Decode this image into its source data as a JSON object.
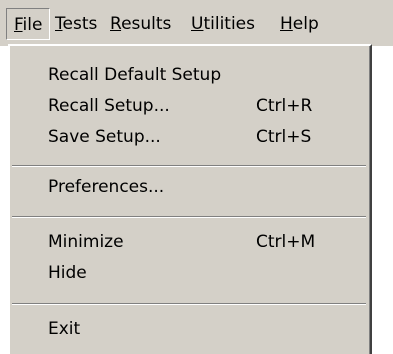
{
  "menubar": {
    "items": [
      {
        "mnemonic": "F",
        "rest": "ile"
      },
      {
        "mnemonic": "T",
        "rest": "ests"
      },
      {
        "mnemonic": "R",
        "rest": "esults"
      },
      {
        "mnemonic": "U",
        "rest": "tilities"
      },
      {
        "mnemonic": "H",
        "rest": "elp"
      }
    ]
  },
  "file_menu": {
    "items": [
      {
        "label": "Recall Default Setup",
        "shortcut": ""
      },
      {
        "label": "Recall Setup...",
        "shortcut": "Ctrl+R"
      },
      {
        "label": "Save Setup...",
        "shortcut": "Ctrl+S"
      },
      {
        "label": "Preferences...",
        "shortcut": ""
      },
      {
        "label": "Minimize",
        "shortcut": "Ctrl+M"
      },
      {
        "label": "Hide",
        "shortcut": ""
      },
      {
        "label": "Exit",
        "shortcut": ""
      }
    ]
  },
  "colors": {
    "menu_background": "#d4d0c8",
    "text": "#000000"
  }
}
